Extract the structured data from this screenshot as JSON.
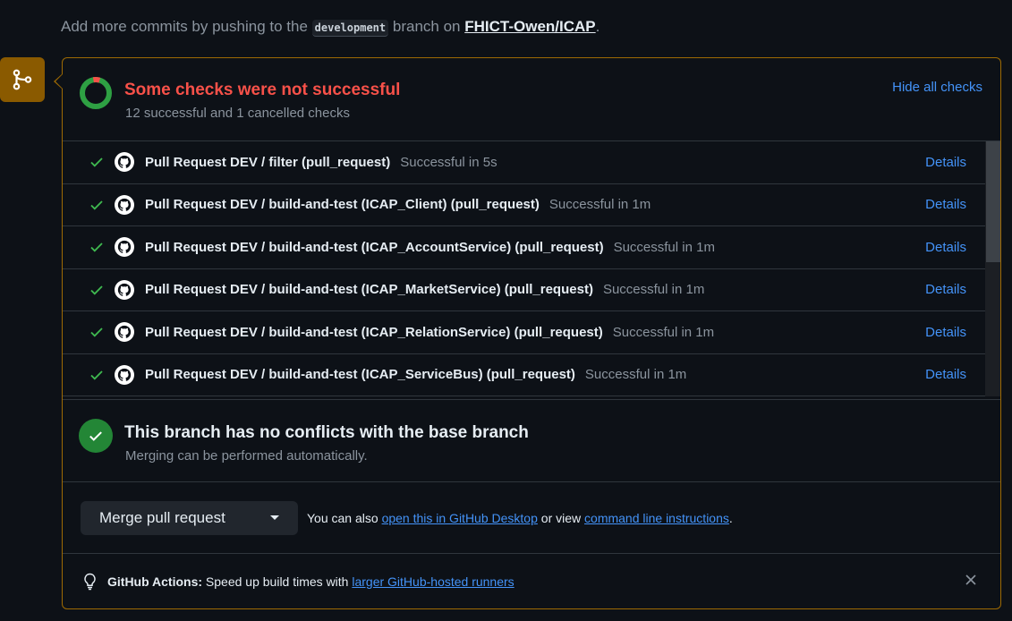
{
  "top": {
    "prefix": "Add more commits by pushing to the",
    "branch": "development",
    "middle": "branch on",
    "repo": "FHICT-Owen/ICAP",
    "suffix": "."
  },
  "checks": {
    "title": "Some checks were not successful",
    "subtitle": "12 successful and 1 cancelled checks",
    "hide_label": "Hide all checks",
    "items": [
      {
        "name": "Pull Request DEV / filter (pull_request)",
        "status": "Successful in 5s",
        "details": "Details"
      },
      {
        "name": "Pull Request DEV / build-and-test (ICAP_Client) (pull_request)",
        "status": "Successful in 1m",
        "details": "Details"
      },
      {
        "name": "Pull Request DEV / build-and-test (ICAP_AccountService) (pull_request)",
        "status": "Successful in 1m",
        "details": "Details"
      },
      {
        "name": "Pull Request DEV / build-and-test (ICAP_MarketService) (pull_request)",
        "status": "Successful in 1m",
        "details": "Details"
      },
      {
        "name": "Pull Request DEV / build-and-test (ICAP_RelationService) (pull_request)",
        "status": "Successful in 1m",
        "details": "Details"
      },
      {
        "name": "Pull Request DEV / build-and-test (ICAP_ServiceBus) (pull_request)",
        "status": "Successful in 1m",
        "details": "Details"
      }
    ]
  },
  "conflicts": {
    "title": "This branch has no conflicts with the base branch",
    "subtitle": "Merging can be performed automatically."
  },
  "merge": {
    "button_label": "Merge pull request",
    "help_prefix": "You can also",
    "desktop_link": "open this in GitHub Desktop",
    "help_middle": "or view",
    "cli_link": "command line instructions",
    "help_suffix": "."
  },
  "actions_tip": {
    "label": "GitHub Actions:",
    "text": "Speed up build times with",
    "link": "larger GitHub-hosted runners"
  },
  "colors": {
    "accent_link": "#4493f8",
    "error": "#f85149",
    "success": "#3fb950",
    "success_bg": "#238636",
    "warning_border": "#9e6a03"
  },
  "icons": [
    "git-merge-icon",
    "status-donut-icon",
    "check-icon",
    "github-mark-icon",
    "lightbulb-icon",
    "close-icon",
    "dropdown-caret-icon"
  ]
}
